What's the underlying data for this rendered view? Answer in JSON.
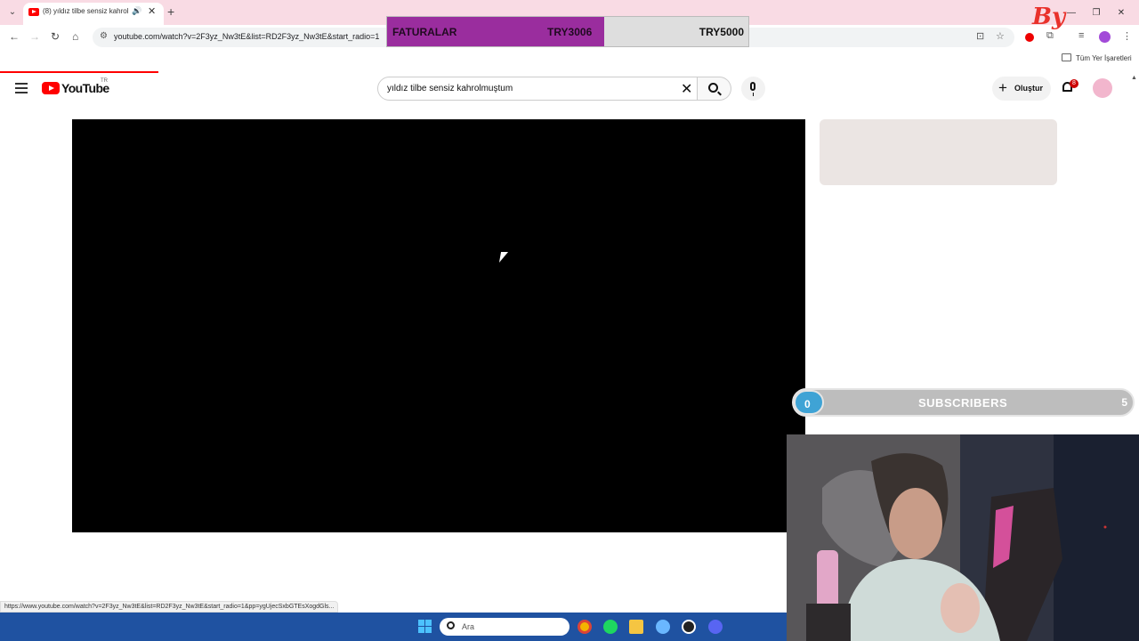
{
  "browser": {
    "tab_title": "(8) yıldız tilbe sensiz kahrol",
    "url": "youtube.com/watch?v=2F3yz_Nw3tE&list=RD2F3yz_Nw3tE&start_radio=1",
    "bookmarks_label": "Tüm Yer İşaretleri",
    "status_link": "https://www.youtube.com/watch?v=2F3yz_Nw3tE&list=RD2F3yz_Nw3tE&start_radio=1&pp=ygUjecSxbGTEsXogdGls..."
  },
  "overlay": {
    "fatura_label": "FATURALAR",
    "fatura_current": "TRY3006",
    "fatura_goal": "TRY5000",
    "fatura_progress": 0.6,
    "logo_text": "By",
    "subs_current": "0",
    "subs_label": "SUBSCRIBERS",
    "subs_goal": "5"
  },
  "youtube": {
    "logo_text": "YouTube",
    "country_code": "TR",
    "search_value": "yıldız tilbe sensiz kahrolmuştum",
    "create_label": "Oluştur",
    "notification_count": "8"
  },
  "taskbar": {
    "search_placeholder": "Ara"
  },
  "colors": {
    "accent": "#ff0000",
    "fatura_fill": "#9a2d9e",
    "taskbar": "#1f52a1",
    "subs_circle": "#3fa3d5"
  }
}
